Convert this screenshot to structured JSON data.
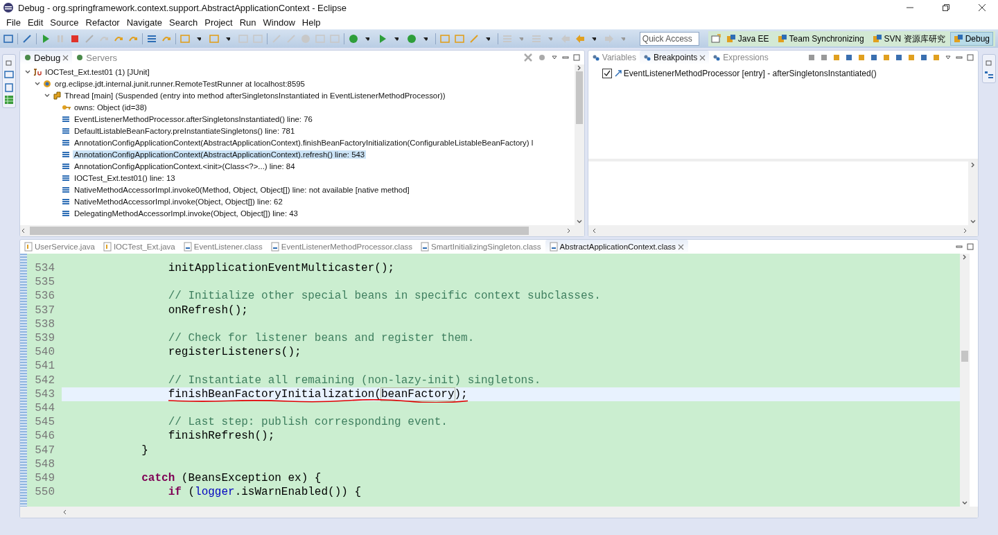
{
  "window": {
    "title": "Debug - org.springframework.context.support.AbstractApplicationContext - Eclipse"
  },
  "menu": [
    "File",
    "Edit",
    "Source",
    "Refactor",
    "Navigate",
    "Search",
    "Project",
    "Run",
    "Window",
    "Help"
  ],
  "quick_access": {
    "placeholder": "Quick Access"
  },
  "perspectives": [
    {
      "label": "Java EE",
      "selected": false
    },
    {
      "label": "Team Synchronizing",
      "selected": false
    },
    {
      "label": "SVN 资源库研究",
      "selected": false
    },
    {
      "label": "Debug",
      "selected": true
    }
  ],
  "debug_view": {
    "tabs": [
      {
        "label": "Debug",
        "selected": true
      },
      {
        "label": "Servers",
        "selected": false
      }
    ],
    "tree": [
      {
        "kind": "launch",
        "label": "IOCTest_Ext.test01 (1) [JUnit]",
        "selected": false,
        "expanded": true,
        "children": [
          {
            "kind": "target",
            "label": "org.eclipse.jdt.internal.junit.runner.RemoteTestRunner at localhost:8595",
            "selected": false,
            "expanded": true,
            "children": [
              {
                "kind": "thread",
                "label": "Thread [main] (Suspended (entry into method afterSingletonsInstantiated in EventListenerMethodProcessor))",
                "selected": false,
                "expanded": true,
                "children": [
                  {
                    "kind": "monitor",
                    "label": "owns: Object  (id=38)",
                    "selected": false
                  },
                  {
                    "kind": "frame",
                    "label": "EventListenerMethodProcessor.afterSingletonsInstantiated() line: 76",
                    "selected": false
                  },
                  {
                    "kind": "frame",
                    "label": "DefaultListableBeanFactory.preInstantiateSingletons() line: 781",
                    "selected": false
                  },
                  {
                    "kind": "frame",
                    "label": "AnnotationConfigApplicationContext(AbstractApplicationContext).finishBeanFactoryInitialization(ConfigurableListableBeanFactory) l",
                    "selected": false
                  },
                  {
                    "kind": "frame",
                    "label": "AnnotationConfigApplicationContext(AbstractApplicationContext).refresh() line: 543",
                    "selected": true
                  },
                  {
                    "kind": "frame",
                    "label": "AnnotationConfigApplicationContext.<init>(Class<?>...) line: 84",
                    "selected": false
                  },
                  {
                    "kind": "frame",
                    "label": "IOCTest_Ext.test01() line: 13",
                    "selected": false
                  },
                  {
                    "kind": "frame",
                    "label": "NativeMethodAccessorImpl.invoke0(Method, Object, Object[]) line: not available [native method]",
                    "selected": false
                  },
                  {
                    "kind": "frame",
                    "label": "NativeMethodAccessorImpl.invoke(Object, Object[]) line: 62",
                    "selected": false
                  },
                  {
                    "kind": "frame",
                    "label": "DelegatingMethodAccessorImpl.invoke(Object, Object[]) line: 43",
                    "selected": false
                  }
                ]
              }
            ]
          }
        ]
      }
    ]
  },
  "breakpoints_view": {
    "tabs": [
      {
        "label": "Variables",
        "selected": false
      },
      {
        "label": "Breakpoints",
        "selected": true
      },
      {
        "label": "Expressions",
        "selected": false
      }
    ],
    "breakpoints": [
      {
        "label": "EventListenerMethodProcessor [entry] - afterSingletonsInstantiated()",
        "checked": true
      }
    ]
  },
  "editor": {
    "tabs": [
      {
        "label": "UserService.java",
        "kind": "java",
        "selected": false
      },
      {
        "label": "IOCTest_Ext.java",
        "kind": "java",
        "selected": false
      },
      {
        "label": "EventListener.class",
        "kind": "class",
        "selected": false
      },
      {
        "label": "EventListenerMethodProcessor.class",
        "kind": "class",
        "selected": false
      },
      {
        "label": "SmartInitializingSingleton.class",
        "kind": "class",
        "selected": false
      },
      {
        "label": "AbstractApplicationContext.class",
        "kind": "class",
        "selected": true
      }
    ],
    "lines": [
      {
        "number": "534",
        "current": false,
        "marked": false,
        "tokens": [
          {
            "text": "                initApplicationEventMulticaster();",
            "kind": "plain"
          }
        ]
      },
      {
        "number": "535",
        "current": false,
        "marked": false
      },
      {
        "number": "536",
        "current": false,
        "marked": false,
        "tokens": [
          {
            "text": "                // Initialize other special beans in specific context subclasses.",
            "kind": "comment"
          }
        ]
      },
      {
        "number": "537",
        "current": false,
        "marked": false,
        "tokens": [
          {
            "text": "                onRefresh();",
            "kind": "plain"
          }
        ]
      },
      {
        "number": "538",
        "current": false,
        "marked": false
      },
      {
        "number": "539",
        "current": false,
        "marked": false,
        "tokens": [
          {
            "text": "                // Check for listener beans and register them.",
            "kind": "comment"
          }
        ]
      },
      {
        "number": "540",
        "current": false,
        "marked": false,
        "tokens": [
          {
            "text": "                registerListeners();",
            "kind": "plain"
          }
        ]
      },
      {
        "number": "541",
        "current": false,
        "marked": false
      },
      {
        "number": "542",
        "current": false,
        "marked": false,
        "tokens": [
          {
            "text": "                // Instantiate all remaining (non-lazy-init) singletons.",
            "kind": "comment"
          }
        ]
      },
      {
        "number": "543",
        "current": true,
        "marked": true,
        "tokens": [
          {
            "text": "                finishBeanFactoryInitialization(",
            "kind": "plain"
          },
          {
            "text": "beanFactory",
            "kind": "occurrence"
          },
          {
            "text": ");",
            "kind": "plain"
          }
        ]
      },
      {
        "number": "544",
        "current": false,
        "marked": false
      },
      {
        "number": "545",
        "current": false,
        "marked": false,
        "tokens": [
          {
            "text": "                // Last step: publish corresponding event.",
            "kind": "comment"
          }
        ]
      },
      {
        "number": "546",
        "current": false,
        "marked": false,
        "tokens": [
          {
            "text": "                finishRefresh();",
            "kind": "plain"
          }
        ]
      },
      {
        "number": "547",
        "current": false,
        "marked": false,
        "tokens": [
          {
            "text": "            }",
            "kind": "plain"
          }
        ]
      },
      {
        "number": "548",
        "current": false,
        "marked": false
      },
      {
        "number": "549",
        "current": false,
        "marked": false,
        "tokens": [
          {
            "text": "            catch",
            "kind": "keyword"
          },
          {
            "text": " (BeansException ex) {",
            "kind": "plain"
          }
        ]
      },
      {
        "number": "550",
        "current": false,
        "marked": false,
        "tokens": [
          {
            "text": "                if",
            "kind": "keyword"
          },
          {
            "text": " (",
            "kind": "plain"
          },
          {
            "text": "logger",
            "kind": "field"
          },
          {
            "text": ".isWarnEnabled()) {",
            "kind": "plain"
          }
        ]
      }
    ]
  }
}
